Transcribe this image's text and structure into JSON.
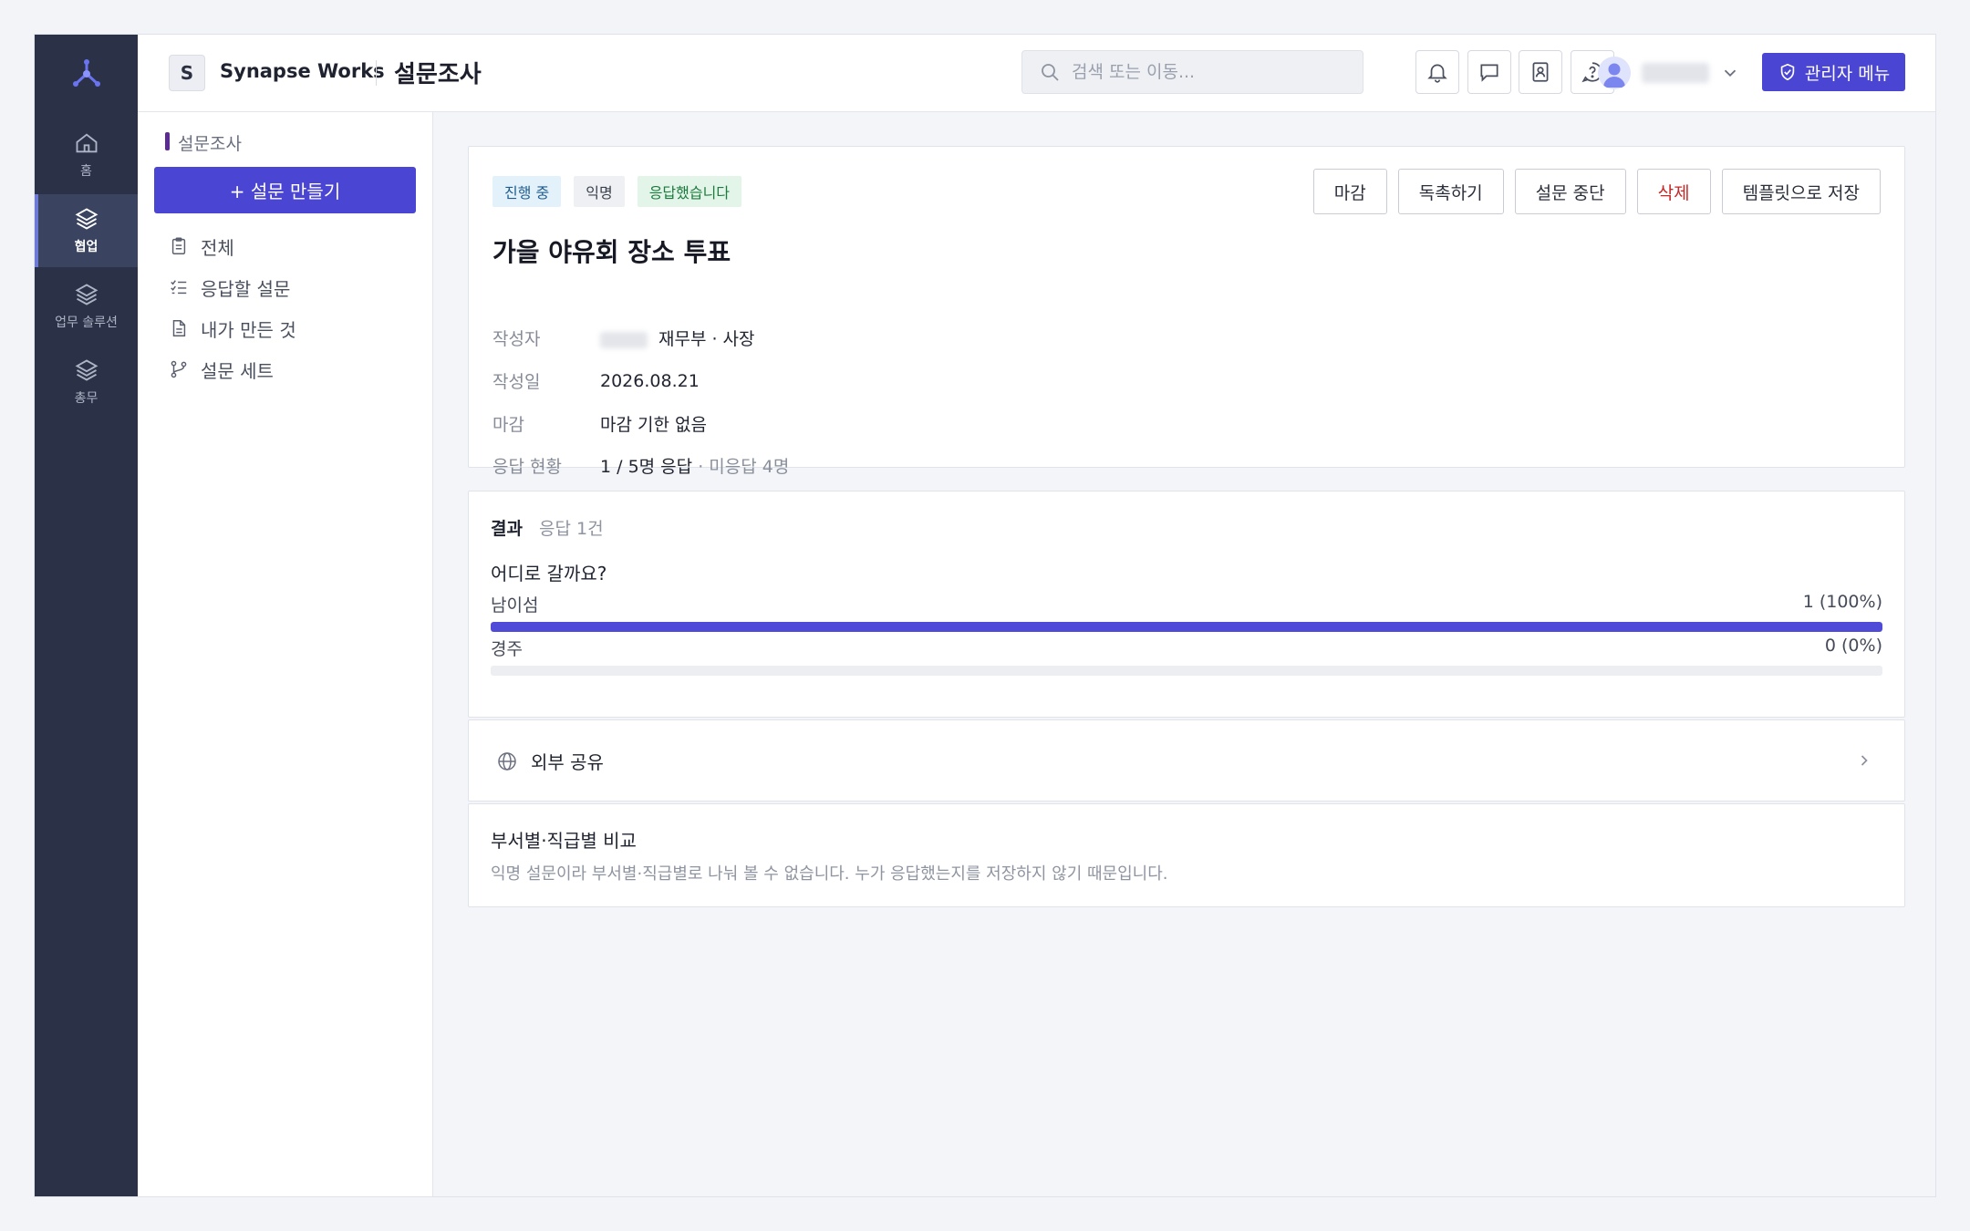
{
  "rail": {
    "items": [
      {
        "label": "홈",
        "icon": "home-icon"
      },
      {
        "label": "협업",
        "icon": "layers-icon",
        "active": true
      },
      {
        "label": "업무 솔루션",
        "icon": "layers-icon"
      },
      {
        "label": "총무",
        "icon": "layers-icon"
      }
    ]
  },
  "header": {
    "workspace_initial": "S",
    "workspace_name": "Synapse Works",
    "page_title": "설문조사",
    "search_placeholder": "검색 또는 이동...",
    "admin_label": "관리자 메뉴"
  },
  "sidebar": {
    "section": "설문조사",
    "create_label": "+ 설문 만들기",
    "items": [
      {
        "label": "전체",
        "icon": "clipboard-icon"
      },
      {
        "label": "응답할 설문",
        "icon": "checklist-icon"
      },
      {
        "label": "내가 만든 것",
        "icon": "document-icon"
      },
      {
        "label": "설문 세트",
        "icon": "branch-icon"
      }
    ]
  },
  "survey": {
    "badges": [
      "진행 중",
      "익명",
      "응답했습니다"
    ],
    "actions": [
      "마감",
      "독촉하기",
      "설문 중단",
      "삭제",
      "템플릿으로 저장"
    ],
    "title": "가을 야유회 장소 투표",
    "meta": {
      "author_label": "작성자",
      "author_dept": "재무부 · 사장",
      "date_label": "작성일",
      "date_value": "2026.08.21",
      "deadline_label": "마감",
      "deadline_value": "마감 기한 없음",
      "status_label": "응답 현황",
      "status_value": "1 / 5명 응답",
      "status_extra": "· 미응답 4명"
    }
  },
  "results": {
    "title": "결과",
    "count": "응답 1건",
    "question": "어디로 갈까요?",
    "options": [
      {
        "label": "남이섬",
        "value": "1 (100%)",
        "fraction": 1.0
      },
      {
        "label": "경주",
        "value": "0 (0%)",
        "fraction": 0.0
      }
    ]
  },
  "share": {
    "label": "외부 공유"
  },
  "compare": {
    "title": "부서별·직급별 비교",
    "desc": "익명 설문이라 부서별·직급별로 나눠 볼 수 없습니다. 누가 응답했는지를 저장하지 않기 때문입니다."
  },
  "colors": {
    "accent": "#4a45d2",
    "rail": "#2b3248",
    "danger": "#c62828"
  }
}
